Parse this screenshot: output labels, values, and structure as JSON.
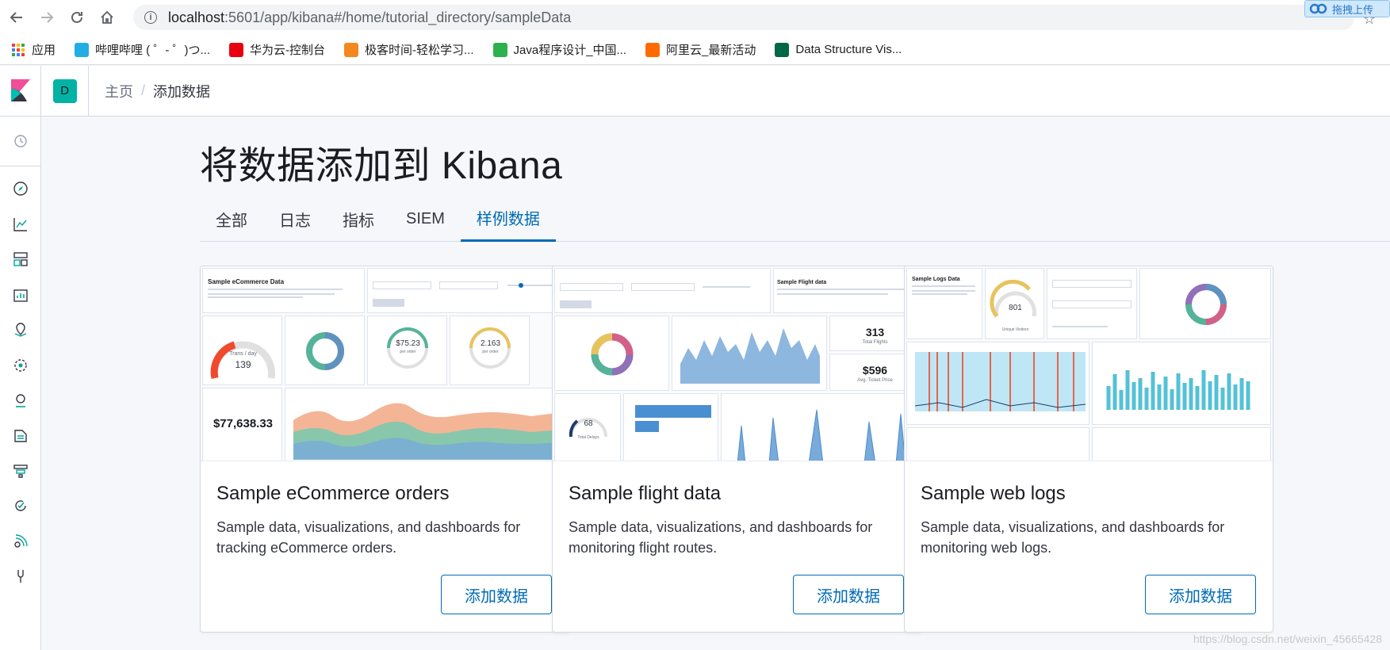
{
  "browser": {
    "url_host": "localhost",
    "url_path": ":5601/app/kibana#/home/tutorial_directory/sampleData",
    "extension_label": "拖拽上传",
    "bookmarks": [
      {
        "label": "应用",
        "icon": "apps-grid-icon",
        "color": "#4285f4"
      },
      {
        "label": "哔哩哔哩 ( ゜- ゜)つ...",
        "icon": "bilibili-icon",
        "color": "#23ade5"
      },
      {
        "label": "华为云-控制台",
        "icon": "huawei-icon",
        "color": "#e60012"
      },
      {
        "label": "极客时间-轻松学习...",
        "icon": "geektime-icon",
        "color": "#f5871f"
      },
      {
        "label": "Java程序设计_中国...",
        "icon": "mooc-icon",
        "color": "#2bb24c"
      },
      {
        "label": "阿里云_最新活动",
        "icon": "aliyun-icon",
        "color": "#ff6a00"
      },
      {
        "label": "Data Structure Vis...",
        "icon": "usf-icon",
        "color": "#006747"
      }
    ]
  },
  "header": {
    "space_initial": "D",
    "breadcrumb_home": "主页",
    "breadcrumb_current": "添加数据"
  },
  "page": {
    "title": "将数据添加到 Kibana",
    "tabs": [
      "全部",
      "日志",
      "指标",
      "SIEM",
      "样例数据"
    ],
    "active_tab": "样例数据"
  },
  "cards": [
    {
      "title": "Sample eCommerce orders",
      "description": "Sample data, visualizations, and dashboards for tracking eCommerce orders.",
      "button": "添加数据",
      "thumb": {
        "markdown_title": "Sample eCommerce Data",
        "trans_label": "Trans / day",
        "trans_value": "139",
        "avg_price": "$75.23",
        "avg_price_sub": "per order",
        "avg_qty": "2.163",
        "avg_qty_sub": "per order",
        "revenue": "$77,638.33"
      }
    },
    {
      "title": "Sample flight data",
      "description": "Sample data, visualizations, and dashboards for monitoring flight routes.",
      "button": "添加数据",
      "thumb": {
        "markdown_title": "Sample Flight data",
        "total_flights": "313",
        "total_flights_label": "Total Flights",
        "ticket_price": "$596",
        "ticket_price_label": "Avg. Ticket Price",
        "delays": "68",
        "delays_label": "Total Delays"
      }
    },
    {
      "title": "Sample web logs",
      "description": "Sample data, visualizations, and dashboards for monitoring web logs.",
      "button": "添加数据",
      "thumb": {
        "markdown_title": "Sample Logs Data",
        "visitors": "801",
        "visitors_label": "Unique Visitors"
      }
    }
  ],
  "nav_icons": [
    "clock-icon",
    "discover-compass-icon",
    "visualize-icon",
    "dashboard-icon",
    "canvas-icon",
    "maps-icon",
    "ml-icon",
    "infrastructure-icon",
    "logs-icon",
    "apm-icon",
    "uptime-icon",
    "siem-icon",
    "dev-tools-icon"
  ],
  "watermark": "https://blog.csdn.net/weixin_45665428"
}
